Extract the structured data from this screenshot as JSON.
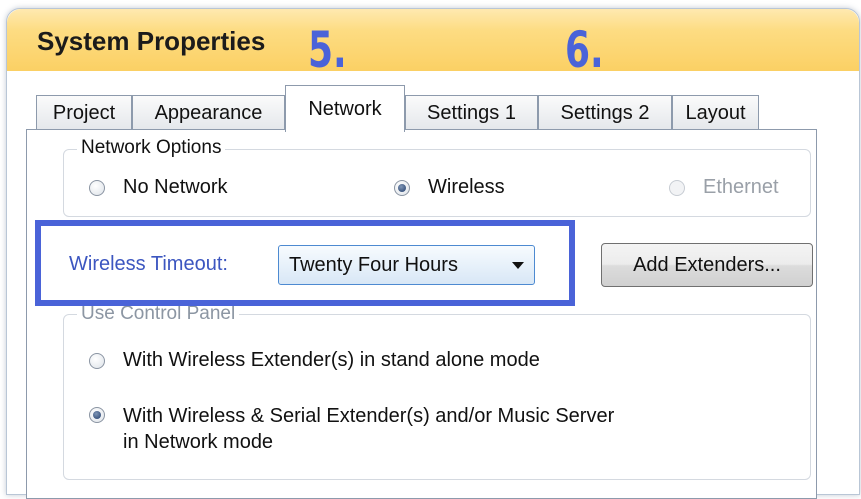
{
  "window": {
    "title": "System Properties"
  },
  "annotations": [
    "5.",
    "6."
  ],
  "tabs": [
    {
      "label": "Project"
    },
    {
      "label": "Appearance"
    },
    {
      "label": "Network",
      "active": true
    },
    {
      "label": "Settings 1"
    },
    {
      "label": "Settings 2"
    },
    {
      "label": "Layout"
    }
  ],
  "network_options": {
    "legend": "Network Options",
    "options": [
      {
        "label": "No Network",
        "checked": false,
        "enabled": true
      },
      {
        "label": "Wireless",
        "checked": true,
        "enabled": true
      },
      {
        "label": "Ethernet",
        "checked": false,
        "enabled": false
      }
    ]
  },
  "wireless_timeout": {
    "label": "Wireless Timeout:",
    "value": "Twenty Four Hours"
  },
  "add_extenders_label": "Add Extenders...",
  "control_panel": {
    "legend": "Use Control Panel",
    "options": [
      {
        "label": "With Wireless Extender(s) in stand alone mode",
        "checked": false
      },
      {
        "label_line1": "With Wireless & Serial Extender(s) and/or Music Server",
        "label_line2": "in Network mode",
        "checked": true
      }
    ]
  },
  "colors": {
    "title_bar": "#fbd064",
    "annotation": "#4a63d8",
    "link_label": "#3c56c0",
    "combo_border": "#4d8ad1"
  }
}
